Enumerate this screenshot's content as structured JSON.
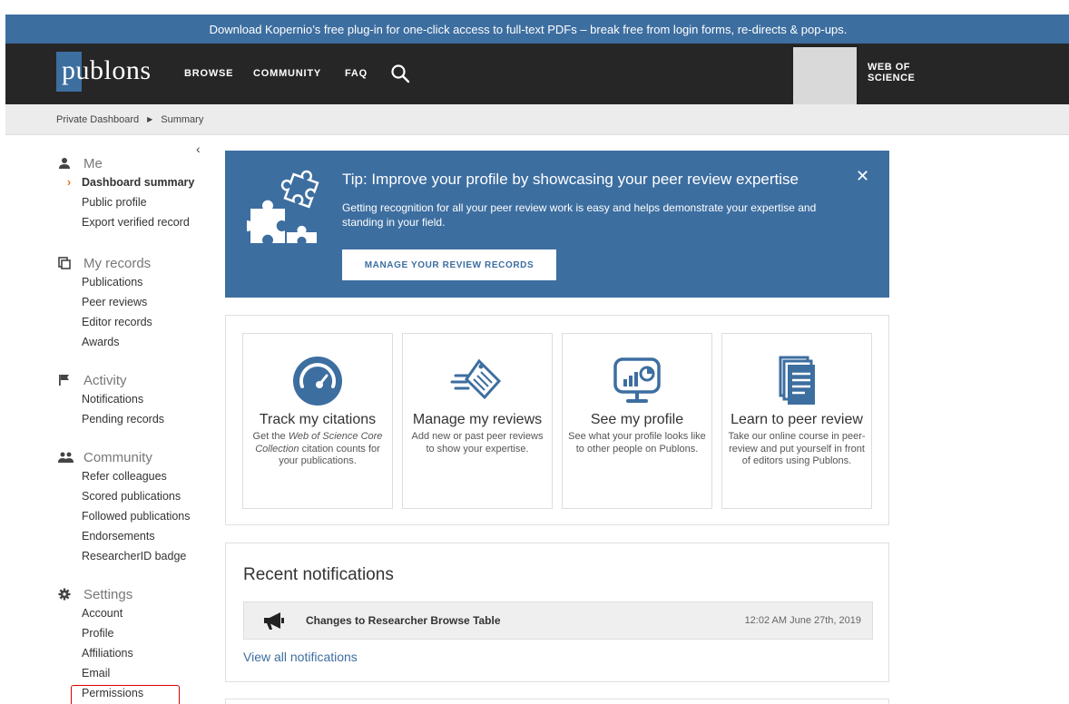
{
  "banner": {
    "text": "Download Kopernio’s free plug-in for one-click access to full-text PDFs – break free from login forms, re-directs & pop-ups."
  },
  "nav": {
    "logo": "publons",
    "links": [
      "BROWSE",
      "COMMUNITY",
      "FAQ"
    ],
    "search_icon": "search-icon",
    "wos_line1": "WEB OF",
    "wos_line2": "SCIENCE"
  },
  "breadcrumb": [
    "Private Dashboard",
    "Summary"
  ],
  "sidebar": {
    "collapse": "‹",
    "sections": [
      {
        "title": "Me",
        "icon": "person-icon",
        "items": [
          "Dashboard summary",
          "Public profile",
          "Export verified record"
        ]
      },
      {
        "title": "My records",
        "icon": "records-icon",
        "items": [
          "Publications",
          "Peer reviews",
          "Editor records",
          "Awards"
        ]
      },
      {
        "title": "Activity",
        "icon": "flag-icon",
        "items": [
          "Notifications",
          "Pending records"
        ]
      },
      {
        "title": "Community",
        "icon": "people-icon",
        "items": [
          "Refer colleagues",
          "Scored publications",
          "Followed publications",
          "Endorsements",
          "ResearcherID badge"
        ]
      },
      {
        "title": "Settings",
        "icon": "gear-icon",
        "items": [
          "Account",
          "Profile",
          "Affiliations",
          "Email",
          "Permissions"
        ]
      }
    ],
    "active_item": "Dashboard summary",
    "highlighted_item": "Permissions"
  },
  "tip": {
    "title": "Tip: Improve your profile by showcasing your peer review expertise",
    "body": "Getting recognition for all your peer review work is easy and helps demonstrate your expertise and standing in your field.",
    "button": "MANAGE YOUR REVIEW RECORDS",
    "close": "✕"
  },
  "cards": [
    {
      "title": "Track my citations",
      "desc_pre": "Get the ",
      "desc_em": "Web of Science Core Collection",
      "desc_post": " citation counts for your publications.",
      "icon": "gauge-icon"
    },
    {
      "title": "Manage my reviews",
      "desc": "Add new or past peer reviews to show your expertise.",
      "icon": "review-tag-icon"
    },
    {
      "title": "See my profile",
      "desc": "See what your profile looks like to other people on Publons.",
      "icon": "monitor-chart-icon"
    },
    {
      "title": "Learn to peer review",
      "desc": "Take our online course in peer-review and put yourself in front of editors using Publons.",
      "icon": "documents-icon"
    }
  ],
  "notifications": {
    "title": "Recent notifications",
    "items": [
      {
        "text": "Changes to Researcher Browse Table",
        "time": "12:02 AM June 27th, 2019",
        "icon": "megaphone-icon"
      }
    ],
    "view_all": "View all notifications"
  },
  "colors": {
    "brand": "#3d6ea0",
    "nav_bg": "#262626",
    "accent": "#e8711c",
    "highlight": "#dd0000"
  }
}
